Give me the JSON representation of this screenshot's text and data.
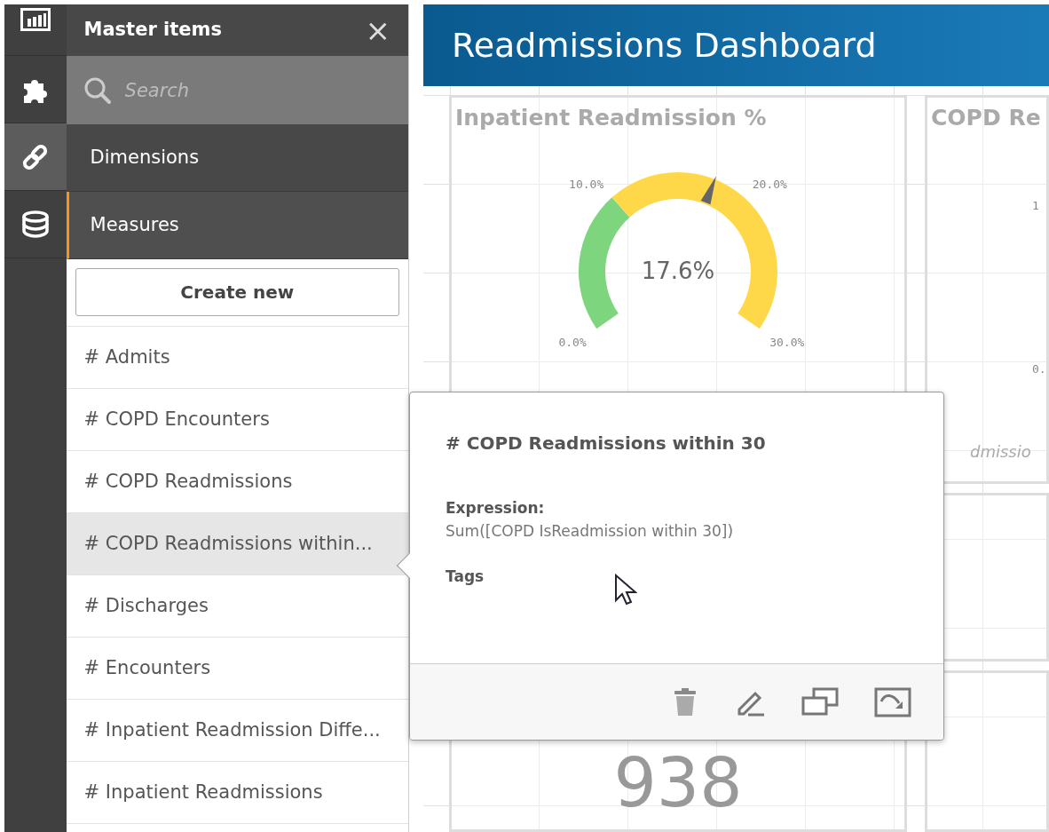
{
  "rail": {
    "items": [
      {
        "kind": "charts",
        "selected": false
      },
      {
        "kind": "extensions",
        "selected": false
      },
      {
        "kind": "master",
        "selected": true
      },
      {
        "kind": "fields",
        "selected": false
      }
    ]
  },
  "panel": {
    "title": "Master items",
    "close": "×",
    "search": {
      "placeholder": "Search"
    },
    "sections": [
      {
        "label": "Dimensions",
        "selected": false
      },
      {
        "label": "Measures",
        "selected": true
      }
    ],
    "create_button": "Create new",
    "items": [
      {
        "label": "# Admits",
        "selected": false
      },
      {
        "label": "# COPD Encounters",
        "selected": false
      },
      {
        "label": "# COPD Readmissions",
        "selected": false
      },
      {
        "label": "# COPD Readmissions within...",
        "selected": true
      },
      {
        "label": "# Discharges",
        "selected": false
      },
      {
        "label": "# Encounters",
        "selected": false
      },
      {
        "label": "# Inpatient Readmission Diffe...",
        "selected": false
      },
      {
        "label": "# Inpatient Readmissions",
        "selected": false
      }
    ]
  },
  "dashboard": {
    "title": "Readmissions Dashboard",
    "gauge": {
      "title": "Inpatient Readmission %",
      "value": "17.6%",
      "level": 0.587,
      "ticks": [
        "0.0%",
        "10.0%",
        "20.0%",
        "30.0%"
      ]
    },
    "card_2": {
      "title": "COPD Re",
      "ticks": [
        "1",
        "0."
      ],
      "subtitle": "dmissio"
    },
    "kpi": {
      "value": "938"
    }
  },
  "popover": {
    "title": "# COPD Readmissions within 30",
    "expression_label": "Expression:",
    "expression": "Sum([COPD IsReadmission within 30])",
    "tags_label": "Tags",
    "actions": [
      {
        "kind": "delete"
      },
      {
        "kind": "edit"
      },
      {
        "kind": "duplicate"
      },
      {
        "kind": "export"
      }
    ]
  }
}
